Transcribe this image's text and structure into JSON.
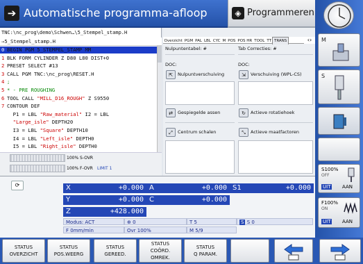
{
  "header": {
    "mode_title": "Automatische programma-afloop",
    "mode_right": "Programmeren"
  },
  "program": {
    "path": "TNC:\\nc_prog\\demo\\Schwen…\\5_Stempel_stamp.H",
    "selected_file": "→5_Stempel_stamp.H",
    "lines": [
      {
        "n": "0",
        "text": "BEGIN PGM 5_STEMPEL_STAMP MM",
        "style": "sel"
      },
      {
        "n": "1",
        "text": "BLK FORM CYLINDER Z D80 L80 DIST+0",
        "style": "kw"
      },
      {
        "n": "2",
        "text": "PRESET SELECT #13",
        "style": "kw"
      },
      {
        "n": "3",
        "text": "CALL PGM TNC:\\nc_prog\\RESET.H",
        "style": "kw"
      },
      {
        "n": "4",
        "text": ";",
        "style": "cmt"
      },
      {
        "n": "5",
        "text": "* - PRE ROUGHING",
        "style": "cmt"
      },
      {
        "n": "6",
        "pre": "TOOL CALL ",
        "str": "\"MILL_D16_ROUGH\"",
        "post": " Z S9550",
        "style": "mix"
      },
      {
        "n": "7",
        "text": "CONTOUR DEF",
        "style": "kw"
      },
      {
        "n": "",
        "pre": "  P1 = LBL ",
        "str": "\"Raw_material\"",
        "post": " I2 = LBL",
        "style": "mix"
      },
      {
        "n": "",
        "pre": "  ",
        "str": "\"Large_isle\"",
        "post": " DEPTH20",
        "style": "mix"
      },
      {
        "n": "",
        "pre": "  I3 = LBL ",
        "str": "\"Square\"",
        "post": " DEPTH10",
        "style": "mix"
      },
      {
        "n": "",
        "pre": "  I4 = LBL ",
        "str": "\"Left_isle\"",
        "post": " DEPTH0",
        "style": "mix"
      },
      {
        "n": "",
        "pre": "  I5 = LBL ",
        "str": "\"Right_isle\"",
        "post": " DEPTH0",
        "style": "mix"
      }
    ]
  },
  "overrides": {
    "spindle": "100% S-OVR",
    "feed": "100% F-OVR",
    "feed_limit": "LIMIT 1"
  },
  "status": {
    "tabs": [
      "Overzicht",
      "PGM",
      "PAL",
      "LBL",
      "CYC",
      "M",
      "POS",
      "POS HR",
      "TOOL",
      "TT",
      "TRANS"
    ],
    "active_tab": "TRANS",
    "nulpunt_label": "Nulpuntentabel: #",
    "tab_corr_label": "Tab Correcties: #",
    "doc_left": "DOC:",
    "doc_right": "DOC:",
    "btn_zero_shift": "Nulpuntverschuiving",
    "btn_shift_wpl": "Verschuiving (WPL-CS)",
    "btn_mirror": "Gespiegelde assen",
    "btn_rotation": "Actieve rotatiehoek",
    "btn_center_scale": "Centrum schalen",
    "btn_scale_factors": "Actieve maatfactoren"
  },
  "positions": {
    "X": "+0.000",
    "A": "+0.000",
    "S1": "+0.000",
    "Y": "+0.000",
    "C": "+0.000",
    "Z": "+428.000"
  },
  "axis_labels": {
    "X": "X",
    "Y": "Y",
    "Z": "Z",
    "A": "A",
    "C": "C",
    "S1": "S1"
  },
  "info": {
    "mode": "Modus: ACT",
    "feed": "F 0mm/min",
    "ovr": "Ovr 100%",
    "tool": "T 5",
    "m": "M 5/9",
    "spindle": "S 0",
    "zero": "0"
  },
  "right_keys": {
    "m": "M",
    "s": "S",
    "s_pct": "S100%",
    "f_pct": "F100%",
    "off": "OFF",
    "on": "ON",
    "aan1": "AAN",
    "uit1": "UIT",
    "aan2": "AAN",
    "uit2": "UIT"
  },
  "softkeys": [
    {
      "l1": "STATUS",
      "l2": "OVERZICHT"
    },
    {
      "l1": "STATUS",
      "l2": "POS.WEERG"
    },
    {
      "l1": "STATUS",
      "l2": "GEREED."
    },
    {
      "l1": "STATUS",
      "l2": "COÖRD.",
      "l3": "OMREK."
    },
    {
      "l1": "STATUS",
      "l2": "Q PARAM."
    }
  ],
  "colors": {
    "accent": "#2452a8",
    "highlight": "#1b3cc8",
    "string": "#c00000",
    "comment": "#0a8a0a"
  }
}
